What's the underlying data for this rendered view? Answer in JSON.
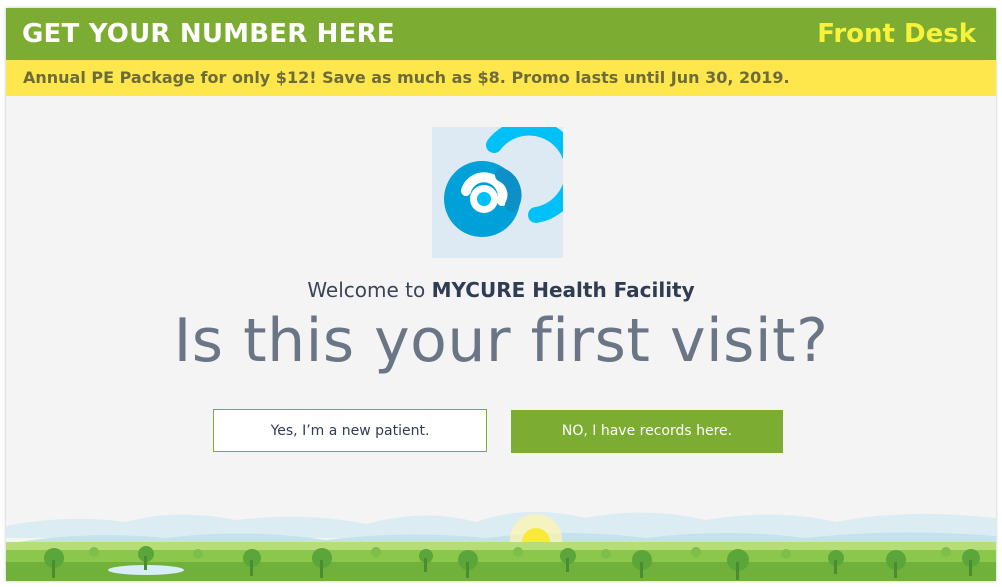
{
  "header": {
    "title": "GET YOUR NUMBER HERE",
    "station": "Front Desk"
  },
  "promo": {
    "text": "Annual PE  Package for only $12! Save as much as $8. Promo lasts until Jun 30, 2019."
  },
  "welcome": {
    "prefix": "Welcome to ",
    "facility": "MYCURE Health Facility"
  },
  "question": "Is this your first visit?",
  "buttons": {
    "new_patient": "Yes, I’m a new patient.",
    "existing": "NO, I have records here."
  },
  "colors": {
    "header_bg": "#7cad32",
    "station_text": "#f8f33a",
    "promo_bg": "#fde74c",
    "logo_blue": "#1aaee6"
  },
  "icons": {
    "logo": "mycure-swirl-logo"
  }
}
